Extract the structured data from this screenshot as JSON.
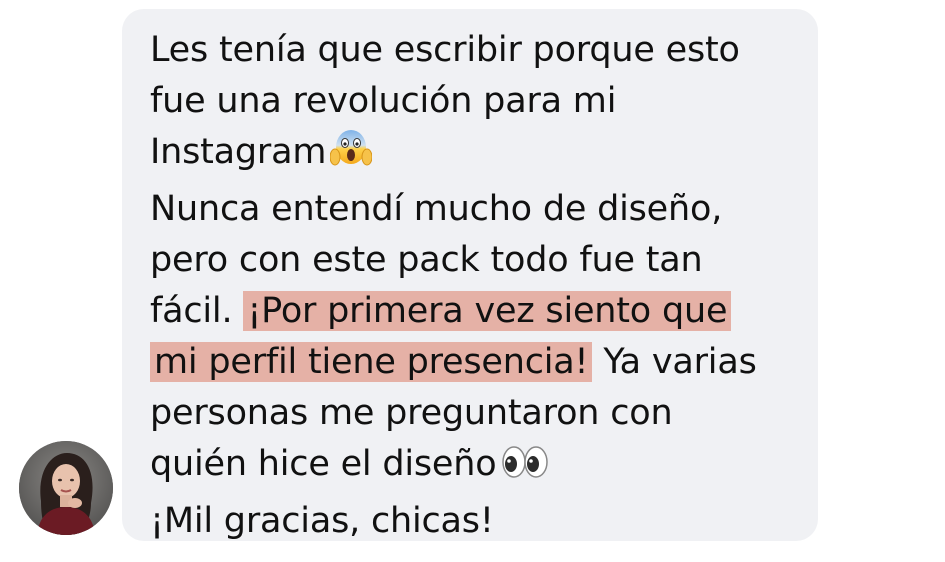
{
  "message": {
    "line1": "Les tenía que escribir porque esto",
    "line2": "fue una revolución para mi",
    "line3": "Instagram",
    "line3_emoji": "face-screaming-in-fear-icon",
    "line4": "Nunca entendí mucho de diseño,",
    "line5": "pero con este pack todo fue tan",
    "line6_a": "fácil.",
    "line6_highlight": "¡Por primera vez siento que",
    "line7_highlight": "mi perfil tiene presencia!",
    "line7_b": "Ya varias",
    "line8": "personas me preguntaron con",
    "line9": "quién hice el diseño",
    "line9_emoji": "eyes-icon",
    "line10": "¡Mil gracias, chicas!"
  },
  "colors": {
    "bubble_bg": "#f0f1f4",
    "highlight": "#e5b1a6",
    "text": "#111111"
  },
  "avatar": {
    "icon": "user-avatar-photo"
  }
}
